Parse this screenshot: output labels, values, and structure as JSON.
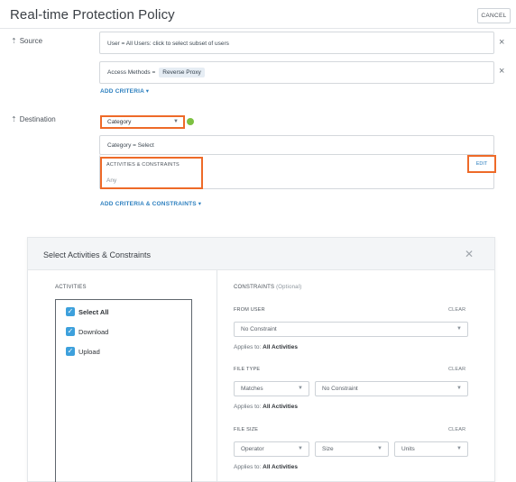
{
  "policy": {
    "title": "Real-time Protection Policy",
    "cancel_label": "CANCEL"
  },
  "source": {
    "label": "Source",
    "users_field": "User = All Users: click to select subset of users",
    "access_prefix": "Access Methods =",
    "access_value": "Reverse Proxy",
    "add_criteria": "ADD CRITERIA ▾"
  },
  "destination": {
    "label": "Destination",
    "category_select": "Category",
    "category_field": "Category = Select",
    "activities_title": "ACTIVITIES & CONSTRAINTS",
    "activities_value": "Any",
    "edit_label": "EDIT",
    "add_criteria_constraints": "ADD CRITERIA & CONSTRAINTS ▾"
  },
  "modal": {
    "title": "Select Activities & Constraints",
    "activities_heading": "ACTIVITIES",
    "constraints_heading": "CONSTRAINTS",
    "constraints_optional": "(Optional)",
    "activities": [
      {
        "label": "Select All",
        "checked": true
      },
      {
        "label": "Download",
        "checked": true
      },
      {
        "label": "Upload",
        "checked": true
      }
    ],
    "from_user": {
      "label": "FROM USER",
      "clear": "CLEAR",
      "value": "No Constraint",
      "applies_prefix": "Applies to:",
      "applies_value": "All Activities"
    },
    "file_type": {
      "label": "FILE TYPE",
      "clear": "CLEAR",
      "operator": "Matches",
      "value": "No Constraint",
      "applies_prefix": "Applies to:",
      "applies_value": "All Activities"
    },
    "file_size": {
      "label": "FILE SIZE",
      "clear": "CLEAR",
      "operator": "Operator",
      "size": "Size",
      "units": "Units",
      "applies_prefix": "Applies to:",
      "applies_value": "All Activities"
    }
  },
  "colors": {
    "highlight": "#ee6a28",
    "link": "#2c7fbf",
    "checkbox": "#3da0dc",
    "status_dot": "#7dc142"
  }
}
